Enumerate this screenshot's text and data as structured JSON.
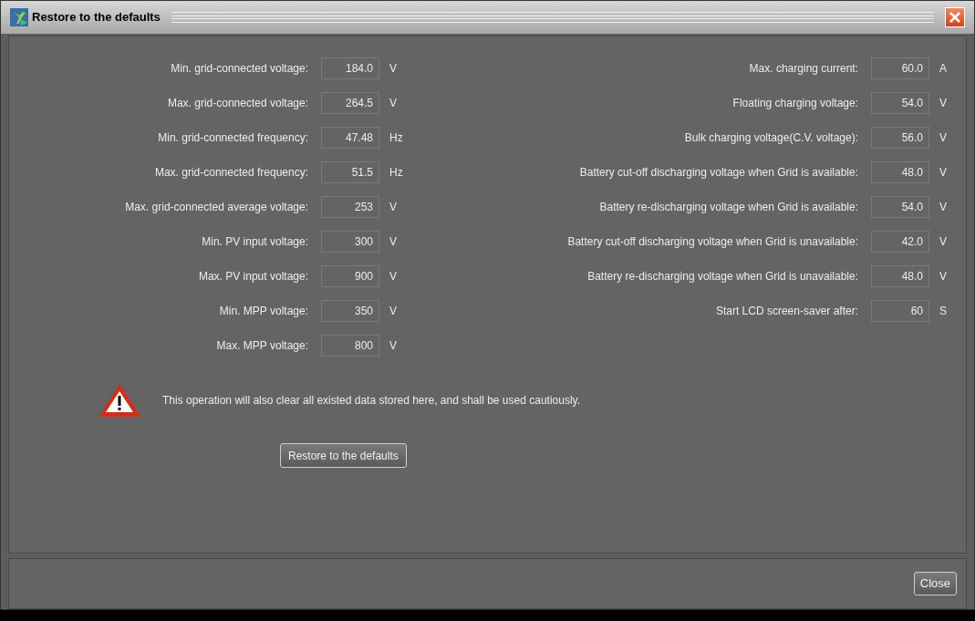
{
  "window": {
    "title": "Restore to the defaults"
  },
  "left_settings": [
    {
      "label": "Min. grid-connected voltage:",
      "value": "184.0",
      "unit": "V"
    },
    {
      "label": "Max. grid-connected voltage:",
      "value": "264.5",
      "unit": "V"
    },
    {
      "label": "Min. grid-connected frequency:",
      "value": "47.48",
      "unit": "Hz"
    },
    {
      "label": "Max. grid-connected frequency:",
      "value": "51.5",
      "unit": "Hz"
    },
    {
      "label": "Max. grid-connected average voltage:",
      "value": "253",
      "unit": "V"
    },
    {
      "label": "Min. PV input voltage:",
      "value": "300",
      "unit": "V"
    },
    {
      "label": "Max. PV input voltage:",
      "value": "900",
      "unit": "V"
    },
    {
      "label": "Min. MPP voltage:",
      "value": "350",
      "unit": "V"
    },
    {
      "label": "Max. MPP voltage:",
      "value": "800",
      "unit": "V"
    }
  ],
  "right_settings": [
    {
      "label": "Max. charging current:",
      "value": "60.0",
      "unit": "A"
    },
    {
      "label": "Floating charging voltage:",
      "value": "54.0",
      "unit": "V"
    },
    {
      "label": "Bulk charging voltage(C.V. voltage):",
      "value": "56.0",
      "unit": "V"
    },
    {
      "label": "Battery cut-off discharging voltage when Grid is available:",
      "value": "48.0",
      "unit": "V"
    },
    {
      "label": "Battery re-discharging voltage when Grid is available:",
      "value": "54.0",
      "unit": "V"
    },
    {
      "label": "Battery cut-off discharging voltage when Grid is unavailable:",
      "value": "42.0",
      "unit": "V"
    },
    {
      "label": "Battery re-discharging voltage when Grid is unavailable:",
      "value": "48.0",
      "unit": "V"
    },
    {
      "label": "Start LCD screen-saver after:",
      "value": "60",
      "unit": "S"
    }
  ],
  "warning": "This operation will also clear all existed data stored here, and shall be used cautiously.",
  "restore_button": "Restore to the defaults",
  "close_button": "Close"
}
